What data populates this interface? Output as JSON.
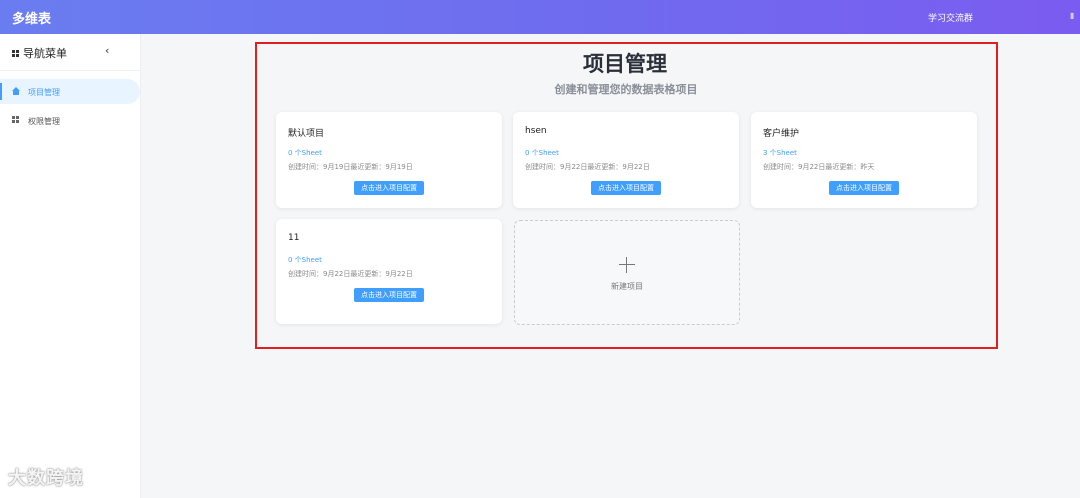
{
  "app": {
    "title": "多维表"
  },
  "header": {
    "study_group": "学习交流群"
  },
  "sidebar": {
    "title": "导航菜单",
    "collapse_icon": "‹",
    "items": [
      {
        "label": "项目管理",
        "icon": "home-icon",
        "active": true
      },
      {
        "label": "权限管理",
        "icon": "grid-icon",
        "active": false
      }
    ]
  },
  "main": {
    "title": "项目管理",
    "subtitle": "创建和管理您的数据表格项目",
    "projects": [
      {
        "name": "默认项目",
        "sheets": "0 个Sheet",
        "meta": "创建时间：9月19日最近更新：9月19日",
        "button": "点击进入项目配置"
      },
      {
        "name": "hsen",
        "sheets": "0 个Sheet",
        "meta": "创建时间：9月22日最近更新：9月22日",
        "button": "点击进入项目配置"
      },
      {
        "name": "客户维护",
        "sheets": "3 个Sheet",
        "meta": "创建时间：9月22日最近更新：昨天",
        "button": "点击进入项目配置"
      },
      {
        "name": "11",
        "sheets": "0 个Sheet",
        "meta": "创建时间：9月22日最近更新：9月22日",
        "button": "点击进入项目配置"
      }
    ],
    "new_project": {
      "label": "新建项目",
      "icon": "plus-icon"
    }
  },
  "watermark": {
    "text": "大数跨境"
  },
  "colors": {
    "accent": "#409eff",
    "header_start": "#6a7df0",
    "header_end": "#7b5cf0",
    "highlight": "#e02020"
  }
}
